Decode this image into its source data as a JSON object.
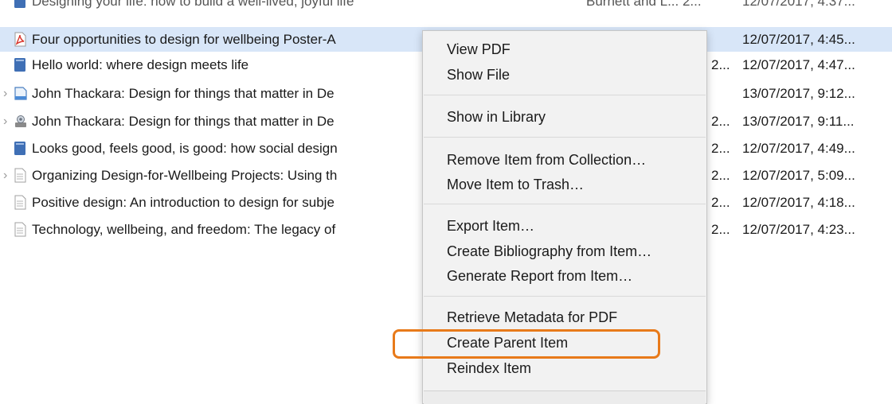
{
  "items": [
    {
      "title": "Designing your life: how to build a well-lived, joyful life",
      "creator": "Burnett and L... 2...",
      "date": "12/07/2017, 4:37..."
    },
    {
      "title": "Four opportunities to design for wellbeing Poster-A",
      "creator": "",
      "date": "12/07/2017, 4:45..."
    },
    {
      "title": "Hello world: where design meets life",
      "creator": "2...",
      "date": "12/07/2017, 4:47..."
    },
    {
      "title": "John Thackara: Design for things that matter in De",
      "creator": "",
      "date": "13/07/2017, 9:12..."
    },
    {
      "title": "John Thackara: Design for things that matter in De",
      "creator": "2...",
      "date": "13/07/2017, 9:11..."
    },
    {
      "title": "Looks good, feels good, is good: how social design",
      "creator": "2...",
      "date": "12/07/2017, 4:49..."
    },
    {
      "title": "Organizing Design-for-Wellbeing Projects: Using th",
      "creator": "2...",
      "date": "12/07/2017, 5:09..."
    },
    {
      "title": "Positive design: An introduction to design for subje",
      "creator": "2...",
      "date": "12/07/2017, 4:18..."
    },
    {
      "title": "Technology, wellbeing, and freedom: The legacy of",
      "creator": "2...",
      "date": "12/07/2017, 4:23..."
    }
  ],
  "menu": {
    "view_pdf": "View PDF",
    "show_file": "Show File",
    "show_in_library": "Show in Library",
    "remove_from_collection": "Remove Item from Collection…",
    "move_to_trash": "Move Item to Trash…",
    "export_item": "Export Item…",
    "create_bibliography": "Create Bibliography from Item…",
    "generate_report": "Generate Report from Item…",
    "retrieve_metadata": "Retrieve Metadata for PDF",
    "create_parent_item": "Create Parent Item",
    "reindex_item": "Reindex Item"
  },
  "colors": {
    "selection": "#d8e6f8",
    "highlight_ring": "#e87a1a",
    "book_icon": "#3f6fb5",
    "pdf_icon": "#d9352b"
  },
  "icons": [
    "book-icon",
    "pdf-icon",
    "book-icon",
    "webpage-icon",
    "film-icon",
    "book-icon",
    "document-icon",
    "document-icon",
    "document-icon"
  ]
}
